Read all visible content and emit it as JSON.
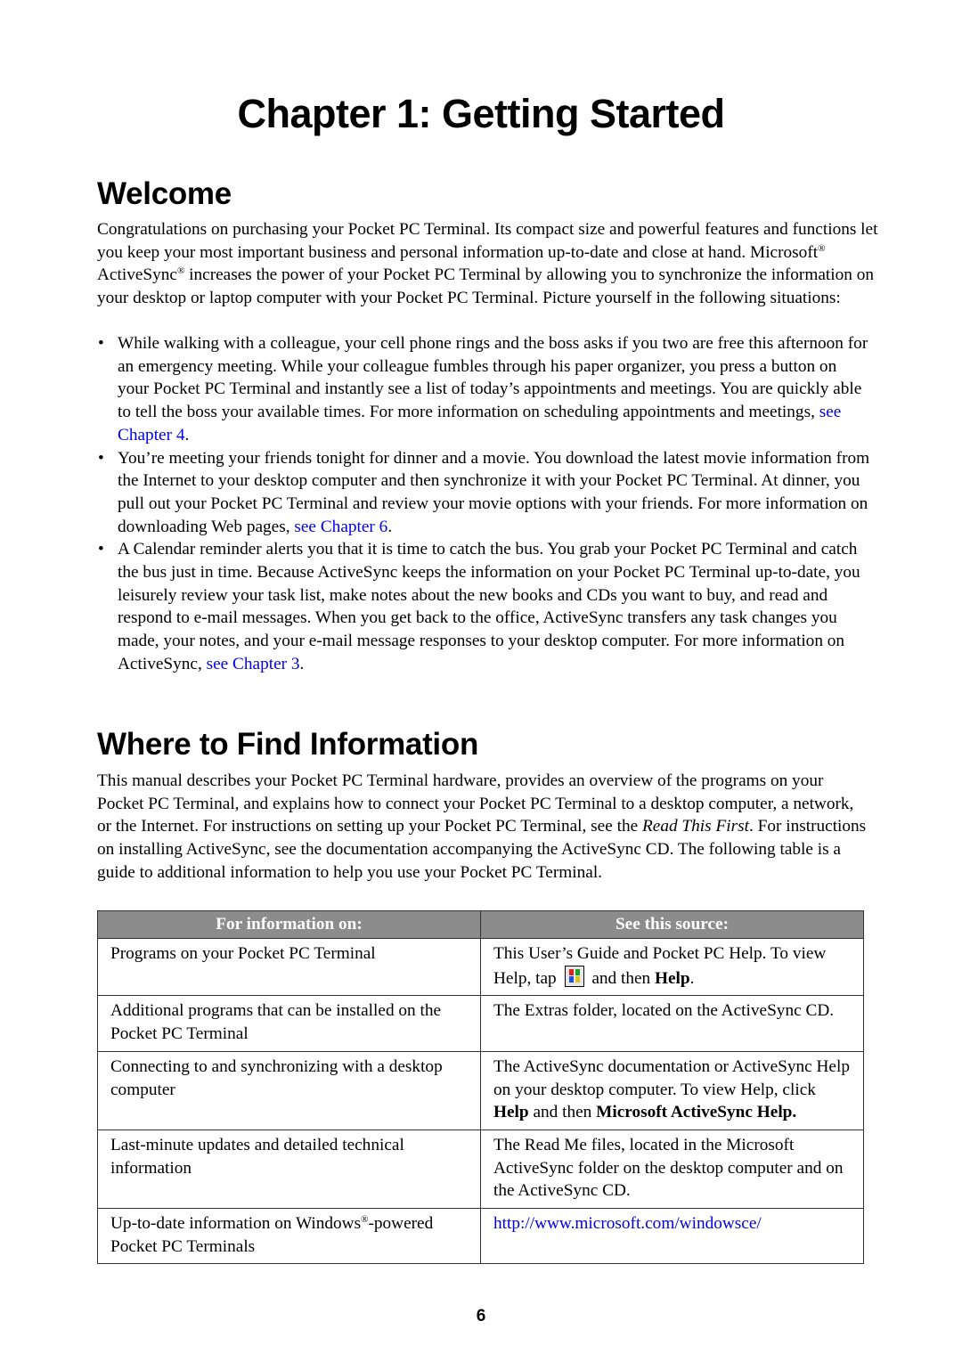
{
  "chapter_title": "Chapter 1:  Getting Started",
  "welcome": {
    "heading": "Welcome",
    "intro_part1": "Congratulations on purchasing your Pocket PC Terminal. Its compact size and powerful features and functions let you keep your most important business and personal information up-to-date and close at hand. Microsoft",
    "reg_mark": "®",
    "intro_part2": " ActiveSync",
    "intro_part3": " increases the power of your Pocket PC Terminal by allowing you to synchronize the information on your desktop or laptop computer with your Pocket PC Terminal. Picture yourself in the following situations:",
    "bullet_glyph": "•",
    "bullets": [
      {
        "text": "While walking with a colleague, your cell phone rings and the boss asks if you two are free this afternoon for an emergency meeting. While your colleague fumbles through his paper organizer, you press a button on your Pocket PC Terminal and instantly see a list of today’s appointments and meetings. You are quickly able to tell the boss your available times. For more information on scheduling appointments and meetings, ",
        "link": "see Chapter 4",
        "tail": "."
      },
      {
        "text": "You’re meeting your friends tonight for dinner and a movie. You download the latest movie information from the Internet to your desktop computer and then synchronize it with your Pocket PC Terminal. At dinner, you pull out your Pocket PC Terminal and review your movie options with your friends. For more information on downloading Web pages, ",
        "link": "see Chapter 6",
        "tail": "."
      },
      {
        "text": "A Calendar reminder alerts you that it is time to catch the bus. You grab your Pocket PC Terminal and catch the bus just in time. Because ActiveSync keeps the information on your Pocket PC Terminal up-to-date, you leisurely review your task list, make notes about the new books and CDs you want to buy, and read and respond to e-mail messages. When you get back to the office, ActiveSync transfers any task changes you made, your notes, and your e-mail message responses to your desktop computer. For more information on ActiveSync, ",
        "link": "see Chapter 3",
        "tail": "."
      }
    ]
  },
  "where": {
    "heading": "Where to Find Information",
    "intro_part1": "This manual describes your Pocket PC Terminal hardware, provides an overview of the programs on your Pocket PC Terminal, and explains how to connect your Pocket PC Terminal to a desktop computer, a network, or the Internet. For instructions on setting up your Pocket PC Terminal, see the ",
    "intro_italic": "Read This First",
    "intro_part2": ". For instructions on installing ActiveSync, see the documentation accompanying the ActiveSync CD. The following table is a guide to additional information to help you use your Pocket PC Terminal."
  },
  "table": {
    "headers": [
      "For information on:",
      "See this source:"
    ],
    "header_bg": "#8c8c8c",
    "rows": [
      {
        "topic": "Programs on your Pocket PC Terminal",
        "source_a": "This User’s Guide and Pocket PC Help. To view Help, tap ",
        "icon": "start-menu-icon",
        "source_b": " and then ",
        "source_bold": "Help",
        "source_c": "."
      },
      {
        "topic": "Additional programs that can be installed on the Pocket PC Terminal",
        "source": "The Extras folder, located on the ActiveSync CD."
      },
      {
        "topic": "Connecting to and synchronizing with a desktop computer",
        "source_a": "The ActiveSync documentation or ActiveSync Help on your desktop computer. To view Help, click ",
        "source_bold1": "Help",
        "source_b": " and then ",
        "source_bold2": "Microsoft ActiveSync Help."
      },
      {
        "topic": "Last-minute updates and detailed technical information",
        "source": "The Read Me files, located in the Microsoft ActiveSync folder on the desktop computer and on the ActiveSync CD."
      },
      {
        "topic_a": "Up-to-date information on Windows",
        "topic_reg": "®",
        "topic_b": "-powered Pocket PC Terminals",
        "source_link": "http://www.microsoft.com/windowsce/"
      }
    ]
  },
  "page_number": "6",
  "colors": {
    "link": "#0000ee",
    "text": "#000000"
  }
}
